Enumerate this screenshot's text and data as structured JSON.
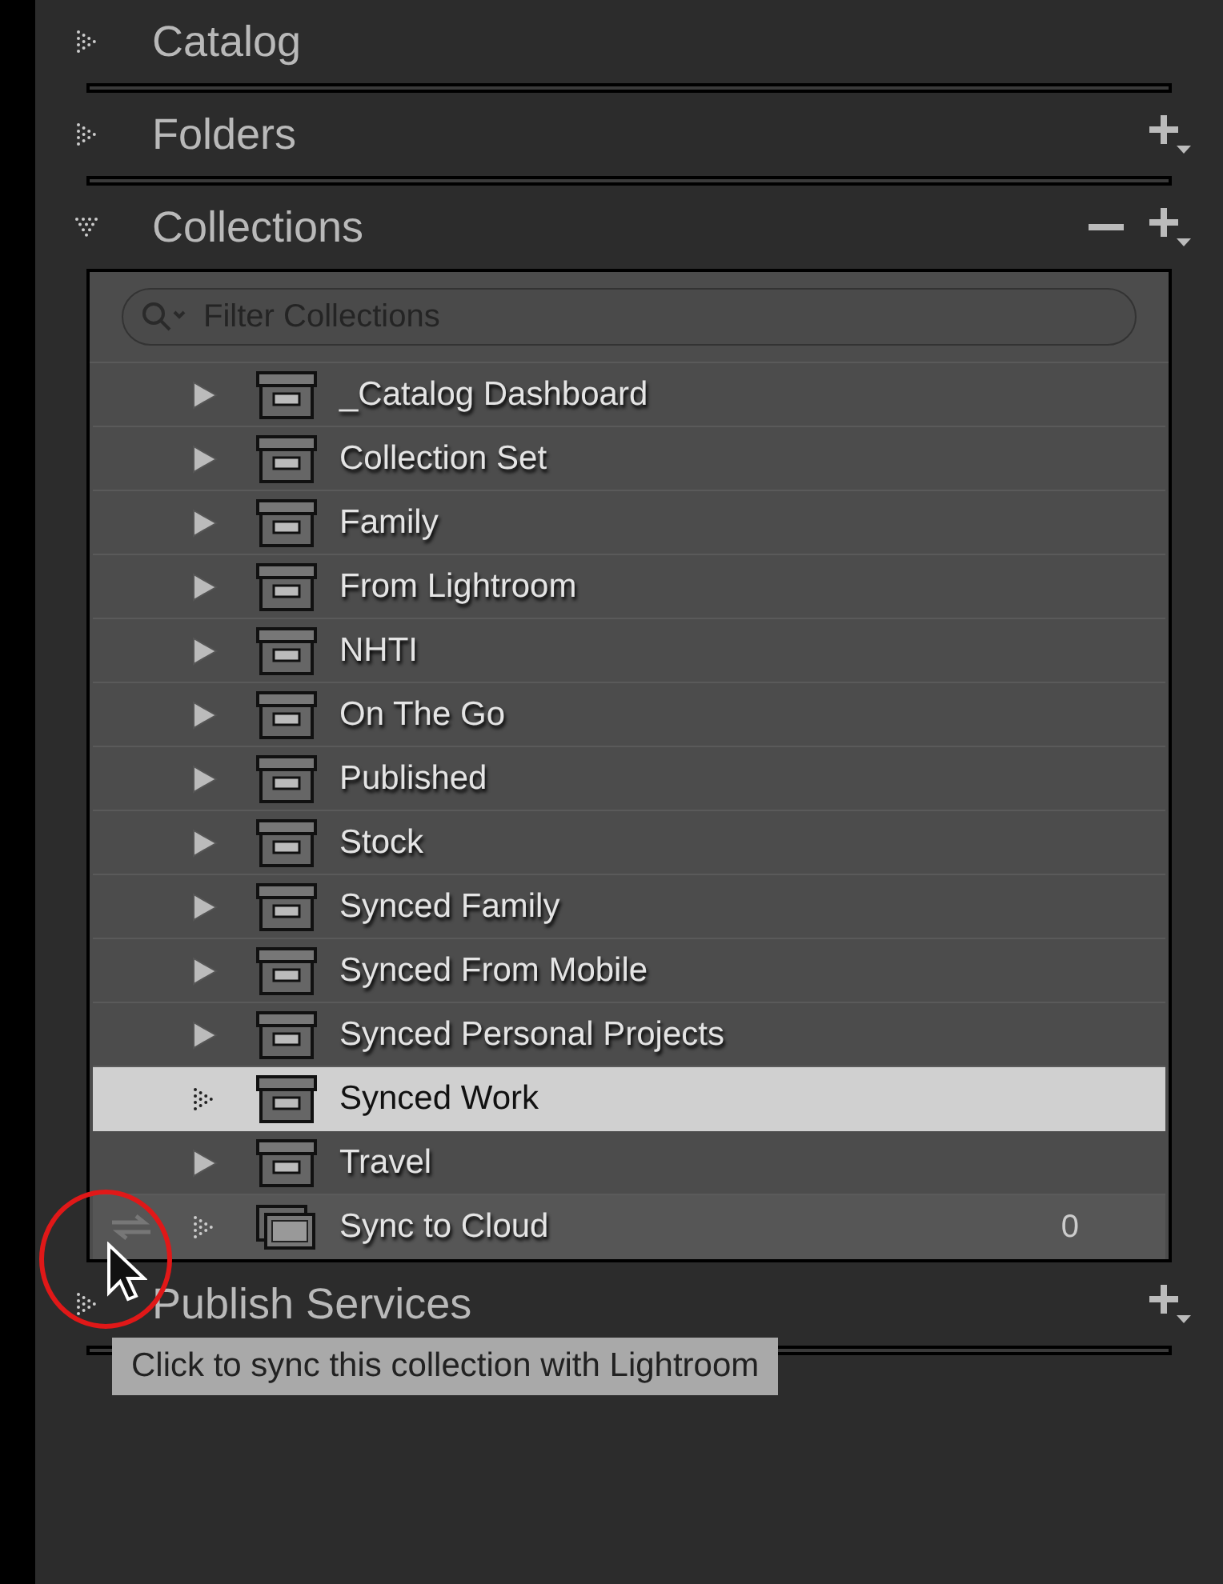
{
  "panels": [
    {
      "title": "Catalog",
      "expanded": false,
      "add": false,
      "remove": false
    },
    {
      "title": "Folders",
      "expanded": false,
      "add": true,
      "remove": false
    },
    {
      "title": "Collections",
      "expanded": true,
      "add": true,
      "remove": true
    }
  ],
  "filter": {
    "placeholder": "Filter Collections"
  },
  "collections": [
    {
      "name": "_Catalog Dashboard",
      "kind": "set",
      "selected": false
    },
    {
      "name": "Collection Set",
      "kind": "set",
      "selected": false
    },
    {
      "name": "Family",
      "kind": "set",
      "selected": false
    },
    {
      "name": "From Lightroom",
      "kind": "set",
      "selected": false
    },
    {
      "name": "NHTI",
      "kind": "set",
      "selected": false
    },
    {
      "name": "On The Go",
      "kind": "set",
      "selected": false
    },
    {
      "name": "Published",
      "kind": "set",
      "selected": false
    },
    {
      "name": "Stock",
      "kind": "set",
      "selected": false
    },
    {
      "name": "Synced Family",
      "kind": "set",
      "selected": false
    },
    {
      "name": "Synced From Mobile",
      "kind": "set",
      "selected": false
    },
    {
      "name": "Synced Personal Projects",
      "kind": "set",
      "selected": false
    },
    {
      "name": "Synced Work",
      "kind": "set",
      "selected": true
    },
    {
      "name": "Travel",
      "kind": "set",
      "selected": false
    },
    {
      "name": "Sync to Cloud",
      "kind": "collection",
      "selected": false,
      "count": "0"
    }
  ],
  "publish_panel": {
    "title": "Publish Services",
    "expanded": false,
    "add": true,
    "remove": false
  },
  "tooltip": "Click to sync this collection with Lightroom"
}
